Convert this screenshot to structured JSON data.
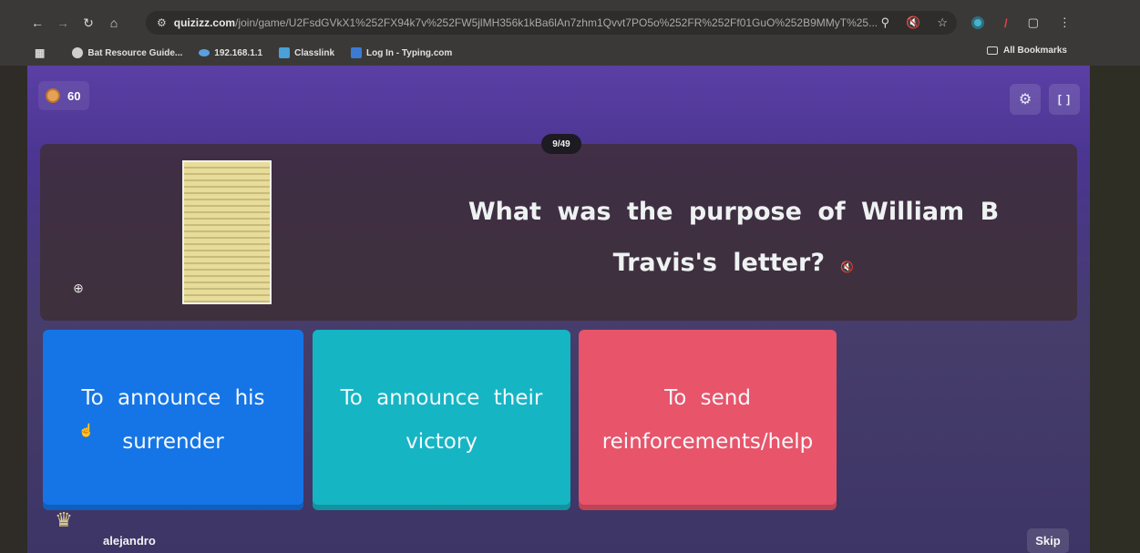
{
  "browser": {
    "url_host": "quizizz.com",
    "url_path": "/join/game/U2FsdGVkX1%252FX94k7v%252FW5jlMH356k1kBa6lAn7zhm1Qvvt7PO5o%252FR%252Ff01GuO%252B9MMyT%25...",
    "nav": {
      "back": "←",
      "forward": "→",
      "reload": "↻",
      "home": "⌂",
      "site_info": "⚙"
    },
    "omnibox_icons": {
      "location": "⚲",
      "muted": "🔇",
      "bookmark_star": "☆"
    },
    "menu_icon": "⋮",
    "bookmarks": [
      {
        "label": "Bat Resource Guide...",
        "icon": "bat-icon",
        "color": "#d0d0d0"
      },
      {
        "label": "192.168.1.1",
        "icon": "cloud-icon",
        "color": "#5aa0e0"
      },
      {
        "label": "Classlink",
        "icon": "classlink-icon",
        "color": "#4aa0d8"
      },
      {
        "label": "Log In - Typing.com",
        "icon": "typing-icon",
        "color": "#3b7bd4"
      }
    ],
    "all_bookmarks_label": "All Bookmarks"
  },
  "game": {
    "coins": "60",
    "question_counter": "9/49",
    "question": "What was the purpose of William B Travis's letter?",
    "tts_icon": "🔇",
    "settings_icon": "⚙",
    "fullscreen_icon": "[ ]",
    "zoom_icon": "⊕",
    "options": [
      {
        "text": "To announce his surrender",
        "color": "#1575e6"
      },
      {
        "text": "To announce their victory",
        "color": "#15b5c4"
      },
      {
        "text": "To send reinforcements/help",
        "color": "#e8546a"
      }
    ],
    "player_name": "alejandro",
    "skip_label": "Skip"
  }
}
